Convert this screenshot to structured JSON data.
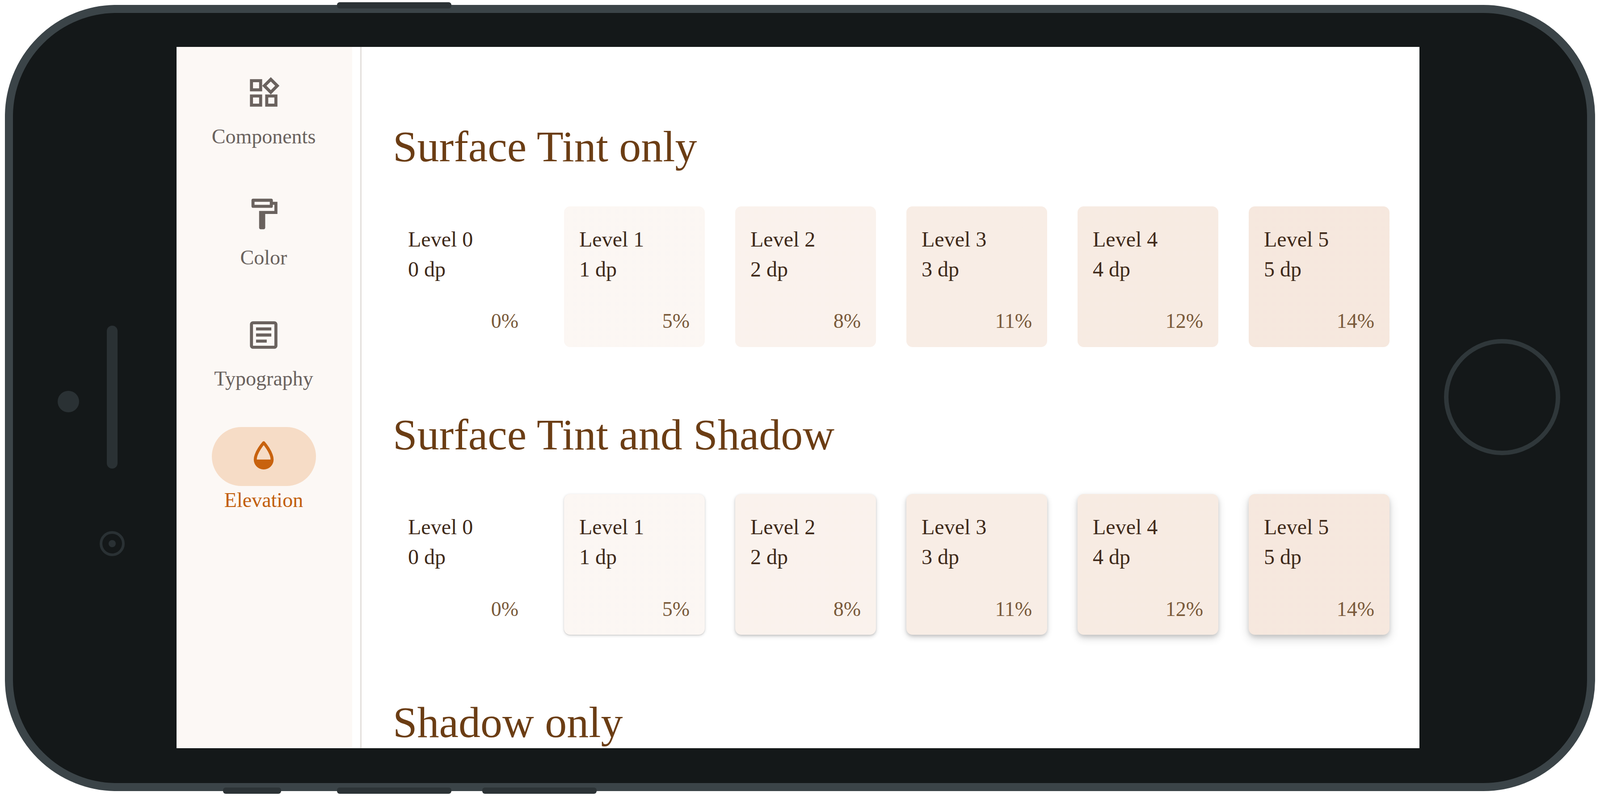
{
  "rail": {
    "items": [
      {
        "label": "Components",
        "selected": false
      },
      {
        "label": "Color",
        "selected": false
      },
      {
        "label": "Typography",
        "selected": false
      },
      {
        "label": "Elevation",
        "selected": true
      }
    ]
  },
  "sections": [
    {
      "title": "Surface Tint only",
      "kind": "tint",
      "cards": [
        {
          "level": "Level 0",
          "dp": "0 dp",
          "percent": "0%"
        },
        {
          "level": "Level 1",
          "dp": "1 dp",
          "percent": "5%"
        },
        {
          "level": "Level 2",
          "dp": "2 dp",
          "percent": "8%"
        },
        {
          "level": "Level 3",
          "dp": "3 dp",
          "percent": "11%"
        },
        {
          "level": "Level 4",
          "dp": "4 dp",
          "percent": "12%"
        },
        {
          "level": "Level 5",
          "dp": "5 dp",
          "percent": "14%"
        }
      ]
    },
    {
      "title": "Surface Tint and Shadow",
      "kind": "tint-shadow",
      "cards": [
        {
          "level": "Level 0",
          "dp": "0 dp",
          "percent": "0%"
        },
        {
          "level": "Level 1",
          "dp": "1 dp",
          "percent": "5%"
        },
        {
          "level": "Level 2",
          "dp": "2 dp",
          "percent": "8%"
        },
        {
          "level": "Level 3",
          "dp": "3 dp",
          "percent": "11%"
        },
        {
          "level": "Level 4",
          "dp": "4 dp",
          "percent": "12%"
        },
        {
          "level": "Level 5",
          "dp": "5 dp",
          "percent": "14%"
        }
      ]
    },
    {
      "title": "Shadow only",
      "kind": "shadow",
      "cards": []
    }
  ]
}
